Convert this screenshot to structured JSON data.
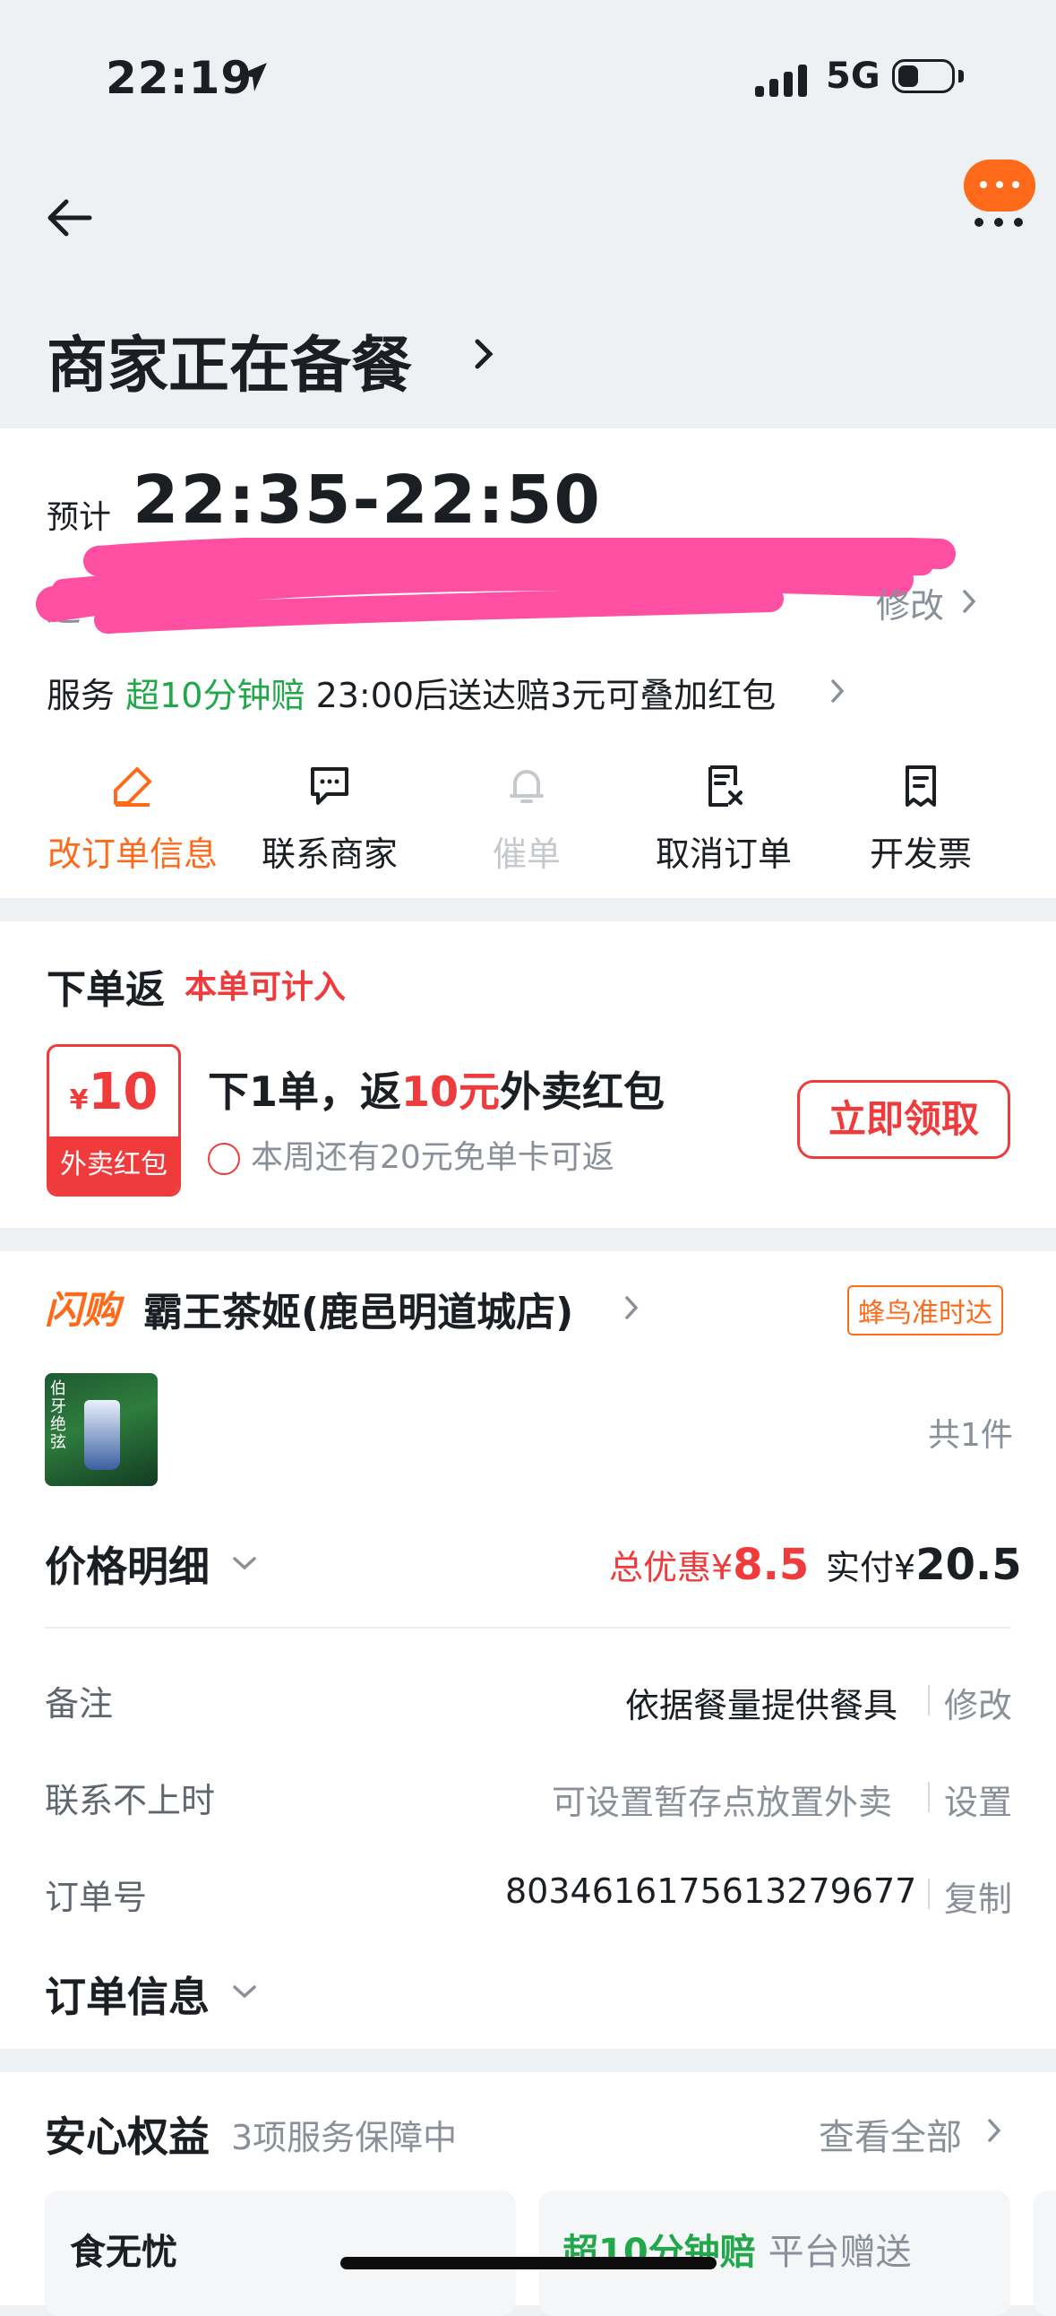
{
  "status_bar": {
    "time": "22:19",
    "network": "5G"
  },
  "header": {
    "status_title": "商家正在备餐"
  },
  "delivery": {
    "eta_label": "预计",
    "eta_time": "22:35-22:50",
    "address_prefix": "送",
    "address_edit": "修改",
    "service_label": "服务",
    "service_highlight": "超10分钟赔",
    "service_text": "23:00后送达赔3元可叠加红包"
  },
  "actions": [
    {
      "label": "改订单信息"
    },
    {
      "label": "联系商家"
    },
    {
      "label": "催单"
    },
    {
      "label": "取消订单"
    },
    {
      "label": "开发票"
    }
  ],
  "rebate": {
    "title": "下单返",
    "tag": "本单可计入",
    "coupon_currency": "¥",
    "coupon_amount": "10",
    "coupon_label": "外卖红包",
    "main_prefix": "下1单，返",
    "main_highlight": "10元",
    "main_suffix": "外卖红包",
    "sub": "本周还有20元免单卡可返",
    "button": "立即领取"
  },
  "store": {
    "brand": "闪购",
    "name": "霸王茶姬(鹿邑明道城店)",
    "badge": "蜂鸟准时达",
    "thumb_text": "伯牙绝弦",
    "item_count": "共1件"
  },
  "price": {
    "title": "价格明细",
    "discount_label": "总优惠",
    "discount_currency": "¥",
    "discount_value": "8.5",
    "paid_label": "实付",
    "paid_currency": "¥",
    "paid_value": "20.5"
  },
  "info": {
    "note_label": "备注",
    "note_value": "依据餐量提供餐具",
    "note_action": "修改",
    "unreachable_label": "联系不上时",
    "unreachable_value": "可设置暂存点放置外卖",
    "unreachable_action": "设置",
    "order_no_label": "订单号",
    "order_no_value": "8034616175613279677",
    "order_no_action": "复制",
    "order_info_title": "订单信息"
  },
  "safety": {
    "title": "安心权益",
    "subtitle": "3项服务保障中",
    "view_all": "查看全部",
    "tile1": "食无忧",
    "tile2_highlight": "超10分钟赔",
    "tile2_text": "平台赠送"
  },
  "colors": {
    "accent": "#ff6a1a",
    "red": "#ef3b3b",
    "green": "#22a84a"
  }
}
